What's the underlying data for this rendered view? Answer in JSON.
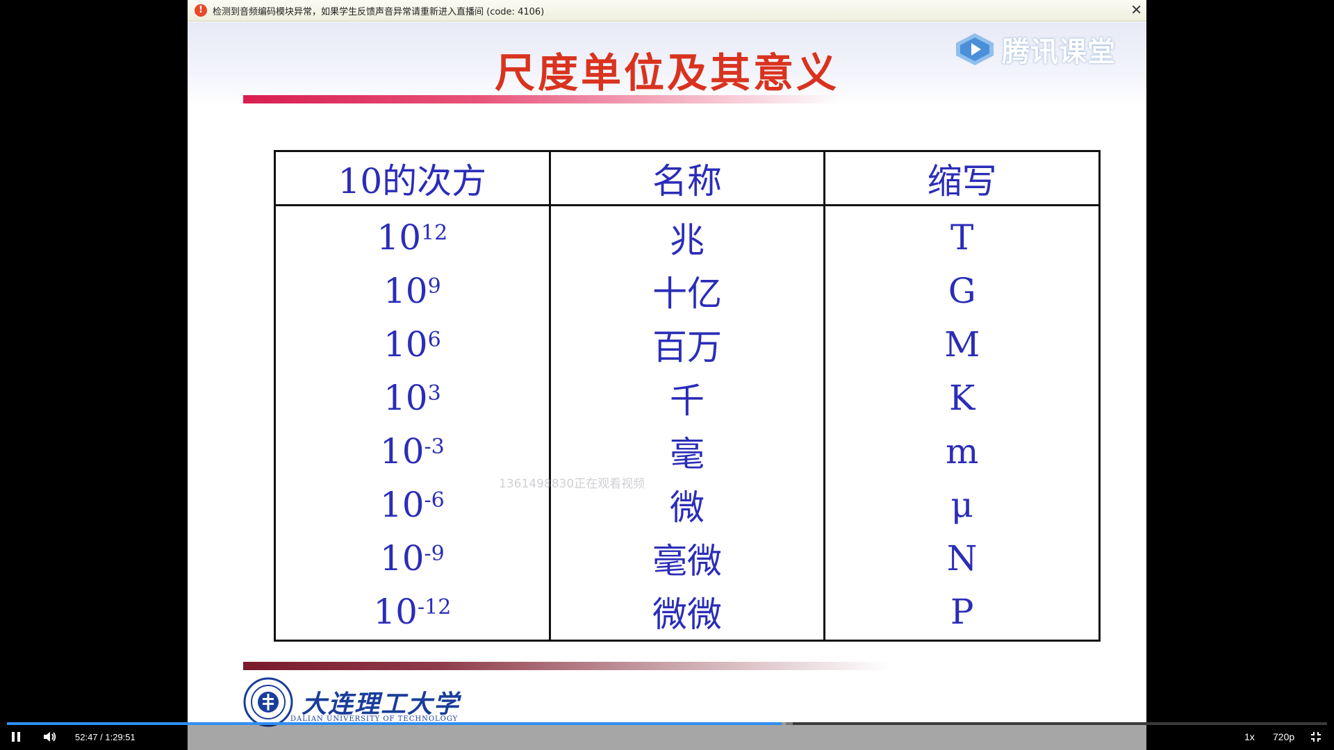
{
  "notice": {
    "icon": "warning-icon",
    "text": "检测到音频编码模块异常，如果学生反馈声音异常请重新进入直播间 (code: 4106)",
    "close_label": "✕"
  },
  "brand": {
    "name": "腾讯课堂",
    "icon": "tencent-classroom-play-icon"
  },
  "slide": {
    "title": "尺度单位及其意义",
    "table": {
      "headers": [
        "10的次方",
        "名称",
        "缩写"
      ],
      "rows": [
        {
          "base": "10",
          "exp": "12",
          "name": "兆",
          "abbr": "T"
        },
        {
          "base": "10",
          "exp": "9",
          "name": "十亿",
          "abbr": "G"
        },
        {
          "base": "10",
          "exp": "6",
          "name": "百万",
          "abbr": "M"
        },
        {
          "base": "10",
          "exp": "3",
          "name": "千",
          "abbr": "K"
        },
        {
          "base": "10",
          "exp": "-3",
          "name": "毫",
          "abbr": "m"
        },
        {
          "base": "10",
          "exp": "-6",
          "name": "微",
          "abbr": "μ"
        },
        {
          "base": "10",
          "exp": "-9",
          "name": "毫微",
          "abbr": "N"
        },
        {
          "base": "10",
          "exp": "-12",
          "name": "微微",
          "abbr": "P"
        }
      ]
    },
    "watermark": "1361498830正在观看视频",
    "school": {
      "name_cn": "大连理工大学",
      "name_en": "DALIAN UNIVERSITY OF TECHNOLOGY"
    }
  },
  "player": {
    "time": "52:47 / 1:29:51",
    "played_fraction": 0.5871,
    "buffered_fraction": 0.59,
    "speed": "1x",
    "quality": "720p",
    "play_state": "pause-icon",
    "volume_icon": "volume-icon",
    "fullscreen_icon": "exit-fullscreen-icon",
    "colors": {
      "progress": "#2f8ff0",
      "title": "#d9331f",
      "table_text": "#2b2db8"
    }
  }
}
